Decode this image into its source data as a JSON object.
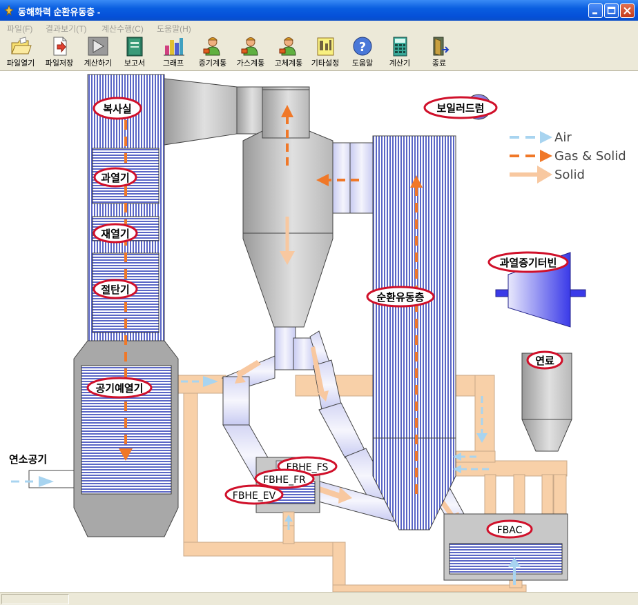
{
  "window": {
    "title": "동해화력 순환유동층 -"
  },
  "menu": [
    {
      "label": "파일(F)"
    },
    {
      "label": "결과보기(T)"
    },
    {
      "label": "계산수행(C)"
    },
    {
      "label": "도움말(H)"
    }
  ],
  "toolbar": [
    {
      "label": "파일열기",
      "icon": "folder-open-icon"
    },
    {
      "label": "파일저장",
      "icon": "save-file-icon"
    },
    {
      "label": "계산하기",
      "icon": "run-icon"
    },
    {
      "label": "보고서",
      "icon": "report-book-icon"
    },
    {
      "label": "그래프",
      "icon": "bar-graph-icon"
    },
    {
      "label": "증기계통",
      "icon": "operator-icon"
    },
    {
      "label": "가스계통",
      "icon": "operator-icon"
    },
    {
      "label": "고체계통",
      "icon": "operator-icon"
    },
    {
      "label": "기타설정",
      "icon": "settings-icon"
    },
    {
      "label": "도움말",
      "icon": "help-icon"
    },
    {
      "label": "계산기",
      "icon": "calculator-icon"
    },
    {
      "label": "종료",
      "icon": "exit-door-icon"
    }
  ],
  "legend": [
    {
      "label": "Air",
      "color": "#a8d4f0"
    },
    {
      "label": "Gas & Solid",
      "color": "#f07828"
    },
    {
      "label": "Solid",
      "color": "#f8c8a0"
    }
  ],
  "diagram": {
    "radiant_chamber": "복사실",
    "superheater": "과열기",
    "reheater": "재열기",
    "economizer": "절탄기",
    "air_preheater": "공기예열기",
    "boiler_drum": "보일러드럼",
    "superheated_turbine": "과열증기터빈",
    "circulating_fluidized_bed": "순환유동층",
    "fuel": "연료",
    "combustion_air": "연소공기",
    "fbhe_fs": "FBHE_FS",
    "fbhe_fr": "FBHE_FR",
    "fbhe_ev": "FBHE_EV",
    "fbac": "FBAC"
  }
}
